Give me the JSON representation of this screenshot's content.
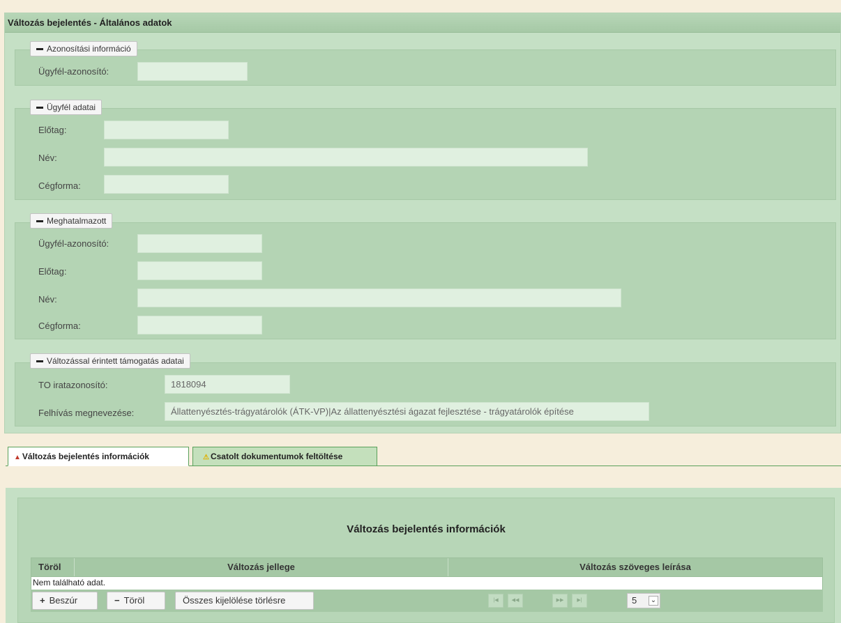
{
  "header": {
    "title": "Változás bejelentés - Általános adatok"
  },
  "sections": {
    "azonositasi": {
      "legend": "Azonosítási információ",
      "ugyfel_azonosito_label": "Ügyfél-azonosító:",
      "ugyfel_azonosito_value": ""
    },
    "ugyfel_adatai": {
      "legend": "Ügyfél adatai",
      "elotag_label": "Előtag:",
      "nev_label": "Név:",
      "cegforma_label": "Cégforma:",
      "elotag_value": "",
      "nev_value": "",
      "cegforma_value": ""
    },
    "meghatalmazott": {
      "legend": "Meghatalmazott",
      "ugyfel_azonosito_label": "Ügyfél-azonosító:",
      "elotag_label": "Előtag:",
      "nev_label": "Név:",
      "cegforma_label": "Cégforma:",
      "ugyfel_azonosito_value": "",
      "elotag_value": "",
      "nev_value": "",
      "cegforma_value": ""
    },
    "tamogatas": {
      "legend": "Változással érintett támogatás adatai",
      "to_label": "TO iratazonosító:",
      "to_value": "1818094",
      "felhivas_label": "Felhívás megnevezése:",
      "felhivas_value": "Állattenyésztés-trágyatárolók (ÁTK-VP)|Az állattenyésztési ágazat fejlesztése - trágyatárolók építése"
    }
  },
  "tabs": [
    {
      "label": "Változás bejelentés információk",
      "active": true,
      "warn": "red"
    },
    {
      "label": "Csatolt dokumentumok feltöltése",
      "active": false,
      "warn": "yellow"
    }
  ],
  "grid": {
    "title": "Változás bejelentés információk",
    "columns": [
      "Töröl",
      "Változás jellege",
      "Változás szöveges leírása"
    ],
    "empty_text": "Nem található adat.",
    "buttons": {
      "insert": "Beszúr",
      "delete": "Töröl",
      "select_all": "Összes kijelölése törlésre"
    },
    "page_size": "5"
  },
  "colors": {
    "panel": "#c5e0c5",
    "fieldset": "#b4d4b4",
    "tab_border": "#5aa05a",
    "warn_red": "#c0392b",
    "warn_yellow": "#e0b000"
  }
}
